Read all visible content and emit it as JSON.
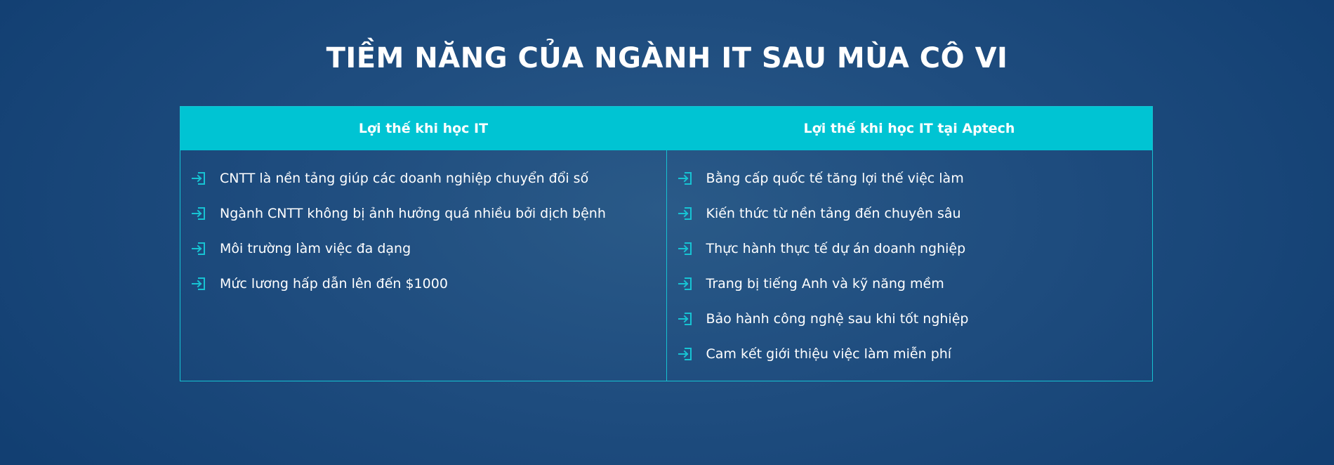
{
  "title": "TIỀM NĂNG CỦA NGÀNH IT SAU MÙA CÔ VI",
  "colors": {
    "accent": "#00c4d3",
    "background": "#1f4d7f",
    "text": "#ffffff"
  },
  "table": {
    "columns": [
      {
        "header": "Lợi thế khi học IT",
        "items": [
          {
            "text": "CNTT là nền tảng giúp các doanh nghiệp chuyển đổi số",
            "icon": "sign-in-icon"
          },
          {
            "text": "Ngành CNTT không bị ảnh hưởng quá nhiều bởi dịch bệnh",
            "icon": "sign-in-icon"
          },
          {
            "text": "Môi trường làm việc đa dạng",
            "icon": "sign-in-icon"
          },
          {
            "text": "Mức lương hấp dẫn lên đến $1000",
            "icon": "sign-in-icon"
          }
        ]
      },
      {
        "header": "Lợi thế khi học IT tại Aptech",
        "items": [
          {
            "text": "Bằng cấp quốc tế tăng lợi thế việc làm",
            "icon": "sign-in-icon"
          },
          {
            "text": "Kiến thức từ nền tảng đến chuyên sâu",
            "icon": "sign-in-icon"
          },
          {
            "text": "Thực hành thực tế dự án doanh nghiệp",
            "icon": "sign-in-icon"
          },
          {
            "text": "Trang bị tiếng Anh và kỹ năng mềm",
            "icon": "sign-in-icon"
          },
          {
            "text": "Bảo hành công nghệ sau khi tốt nghiệp",
            "icon": "sign-in-icon"
          },
          {
            "text": "Cam kết giới thiệu việc làm miễn phí",
            "icon": "sign-in-icon"
          }
        ]
      }
    ]
  }
}
